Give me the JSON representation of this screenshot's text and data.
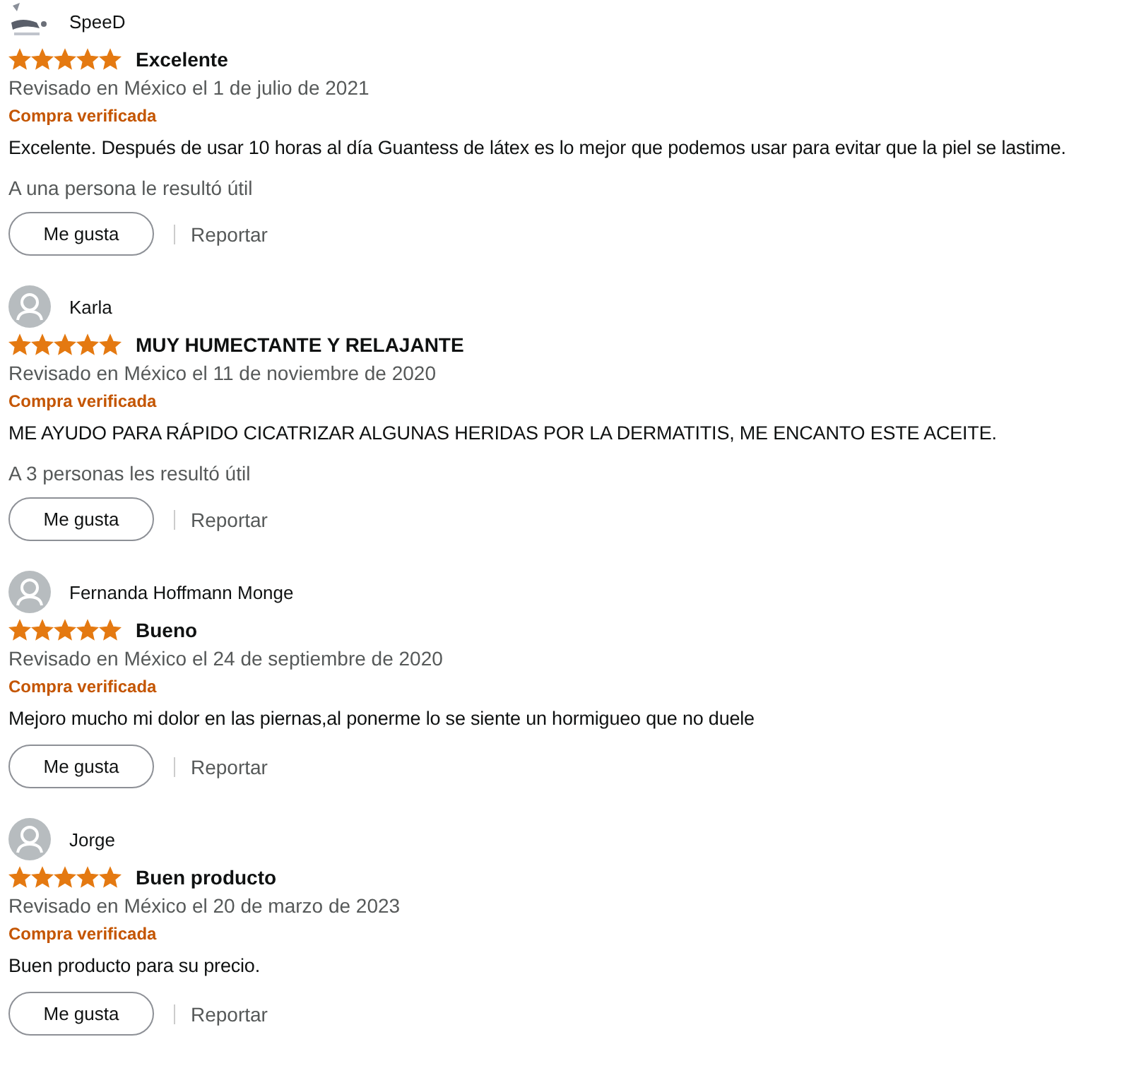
{
  "reviews": [
    {
      "author": "SpeeD",
      "stars": 5,
      "title": "Excelente",
      "date": "Revisado en México el 1 de julio de 2021",
      "badge": "Compra verificada",
      "text": "Excelente. Después de usar 10 horas al día Guantess de látex es lo mejor que podemos usar para evitar que la piel se lastime.",
      "helpful": "A una persona le resultó útil",
      "like_button": "Me gusta",
      "report_link": "Reportar"
    },
    {
      "author": "Karla",
      "avatar": {
        "kind": "default"
      },
      "stars": 5,
      "title": "MUY HUMECTANTE Y RELAJANTE",
      "date": "Revisado en México el 11 de noviembre de 2020",
      "badge": "Compra verificada",
      "text": "ME AYUDO PARA RÁPIDO CICATRIZAR ALGUNAS HERIDAS POR LA DERMATITIS, ME ENCANTO ESTE ACEITE.",
      "helpful": "A 3 personas les resultó útil",
      "like_button": "Me gusta",
      "report_link": "Reportar"
    },
    {
      "author": "Fernanda Hoffmann Monge",
      "avatar": {
        "kind": "default"
      },
      "stars": 5,
      "title": "Bueno",
      "date": "Revisado en México el 24 de septiembre de 2020",
      "badge": "Compra verificada",
      "text": "Mejoro mucho mi dolor en las piernas,al ponerme lo se siente un hormigueo que no duele",
      "like_button": "Me gusta",
      "report_link": "Reportar"
    },
    {
      "author": "Jorge",
      "avatar": {
        "kind": "default"
      },
      "stars": 5,
      "title": "Buen producto",
      "date": "Revisado en México el 20 de marzo de 2023",
      "badge": "Compra verificada",
      "text": "Buen producto para su precio.",
      "like_button": "Me gusta",
      "report_link": "Reportar"
    }
  ]
}
